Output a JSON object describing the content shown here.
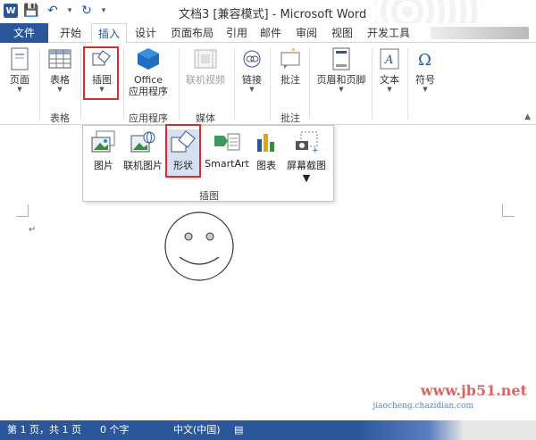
{
  "titlebar": {
    "app_logo": "W",
    "title": "文档3 [兼容模式] - Microsoft Word"
  },
  "tabs": [
    {
      "label": "文件"
    },
    {
      "label": "开始"
    },
    {
      "label": "插入"
    },
    {
      "label": "设计"
    },
    {
      "label": "页面布局"
    },
    {
      "label": "引用"
    },
    {
      "label": "邮件"
    },
    {
      "label": "审阅"
    },
    {
      "label": "视图"
    },
    {
      "label": "开发工具"
    }
  ],
  "ribbon": {
    "buttons": [
      {
        "label": "页面",
        "icon": "page-icon"
      },
      {
        "label": "表格",
        "icon": "table-icon"
      },
      {
        "label": "插图",
        "icon": "illustrations-icon"
      },
      {
        "label": "Office",
        "label2": "应用程序",
        "icon": "office-icon"
      },
      {
        "label": "联机视频",
        "icon": "video-icon"
      },
      {
        "label": "链接",
        "icon": "link-icon"
      },
      {
        "label": "批注",
        "icon": "comment-icon"
      },
      {
        "label": "页眉和页脚",
        "icon": "header-footer-icon"
      },
      {
        "label": "文本",
        "icon": "text-icon"
      },
      {
        "label": "符号",
        "icon": "symbol-icon"
      }
    ],
    "groups": [
      "表格",
      "应用程序",
      "媒体",
      "批注"
    ]
  },
  "dropdown": {
    "items": [
      {
        "label": "图片",
        "icon": "picture-icon"
      },
      {
        "label": "联机图片",
        "icon": "online-picture-icon"
      },
      {
        "label": "形状",
        "icon": "shapes-icon"
      },
      {
        "label": "SmartArt",
        "icon": "smartart-icon"
      },
      {
        "label": "图表",
        "icon": "chart-icon"
      },
      {
        "label": "屏幕截图",
        "icon": "screenshot-icon"
      }
    ],
    "group_label": "插图"
  },
  "status": {
    "page": "第 1 页，共 1 页",
    "words": "0 个字",
    "language": "中文(中国)"
  },
  "watermark": {
    "site": "www.jb51.net",
    "site2": "jiaocheng.chazidian.com"
  },
  "colors": {
    "accent": "#2b579a",
    "highlight": "#d32f2f"
  }
}
